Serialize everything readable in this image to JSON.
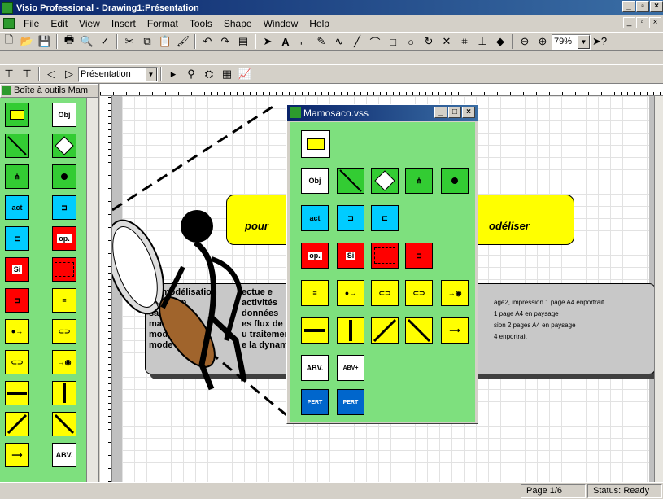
{
  "window": {
    "title": "Visio Professional - Drawing1:Présentation",
    "min": "_",
    "max": "▫",
    "close": "×"
  },
  "menu": {
    "items": [
      "File",
      "Edit",
      "View",
      "Insert",
      "Format",
      "Tools",
      "Shape",
      "Window",
      "Help"
    ],
    "mdi_min": "_",
    "mdi_max": "▫",
    "mdi_close": "×"
  },
  "toolbar": {
    "zoom": "79%",
    "page_combo": "Présentation"
  },
  "stencil": {
    "title": "Boîte à outils Mam"
  },
  "drawing": {
    "yellow_left": "pour",
    "yellow_right": "odéliser",
    "gray_left": [
      "La modélisation",
      "scription",
      "sation",
      "ma",
      "mod",
      "mode"
    ],
    "gray_left2": [
      "ectue e",
      "activités",
      "données",
      "es flux de",
      "u traitemen",
      "e la dynami"
    ],
    "gray_right": [
      "age2, impression 1 page A4 enportrait",
      "1 page A4 en paysage",
      "sion 2 pages A4 en paysage",
      "4 enportrait"
    ],
    "bullet_prefix": "-"
  },
  "float": {
    "title": "Mamosaco.vss"
  },
  "status": {
    "page": "Page 1/6",
    "status": "Status:",
    "ready": "Ready"
  },
  "colors": {
    "accent": "#0a246a",
    "stencil_bg": "#7ee07e",
    "yellow": "#ffff00"
  }
}
